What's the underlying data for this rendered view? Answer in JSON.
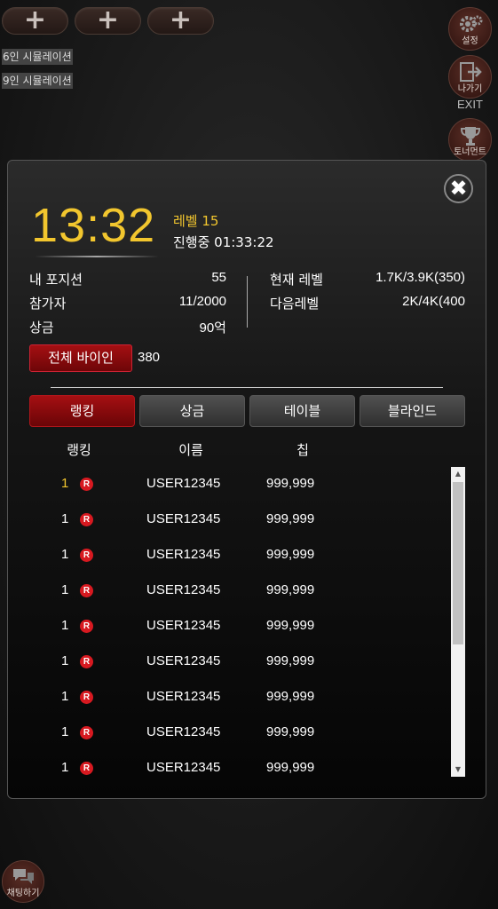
{
  "top_buttons": [
    "+",
    "+",
    "+"
  ],
  "sim_buttons": [
    "6인 시뮬레이션",
    "9인 시뮬레이션"
  ],
  "side": {
    "settings_label": "설정",
    "exit_label": "나가기",
    "exit_text": "EXIT",
    "tournament_label": "토너먼트"
  },
  "modal": {
    "close": "✖",
    "clock": "13:32",
    "level": "레벨 15",
    "progress": "진행중 01:33:22",
    "stats_left": [
      {
        "label": "내 포지션",
        "value": "55"
      },
      {
        "label": "참가자",
        "value": "11/2000"
      },
      {
        "label": "상금",
        "value": "90억"
      }
    ],
    "stats_right": [
      {
        "label": "현재 레벨",
        "value": "1.7K/3.9K(350)"
      },
      {
        "label": "다음레벨",
        "value": "2K/4K(400"
      }
    ],
    "buyin_label": "전체 바이인",
    "buyin_value": "380",
    "tabs": [
      "랭킹",
      "상금",
      "테이블",
      "블라인드"
    ],
    "active_tab": "랭킹",
    "columns": [
      "랭킹",
      "이름",
      "칩"
    ],
    "rows": [
      {
        "rank": "1",
        "badge": "R",
        "name": "USER12345",
        "chips": "999,999"
      },
      {
        "rank": "1",
        "badge": "R",
        "name": "USER12345",
        "chips": "999,999"
      },
      {
        "rank": "1",
        "badge": "R",
        "name": "USER12345",
        "chips": "999,999"
      },
      {
        "rank": "1",
        "badge": "R",
        "name": "USER12345",
        "chips": "999,999"
      },
      {
        "rank": "1",
        "badge": "R",
        "name": "USER12345",
        "chips": "999,999"
      },
      {
        "rank": "1",
        "badge": "R",
        "name": "USER12345",
        "chips": "999,999"
      },
      {
        "rank": "1",
        "badge": "R",
        "name": "USER12345",
        "chips": "999,999"
      },
      {
        "rank": "1",
        "badge": "R",
        "name": "USER12345",
        "chips": "999,999"
      },
      {
        "rank": "1",
        "badge": "R",
        "name": "USER12345",
        "chips": "999,999"
      }
    ],
    "first_rank_color": "#f2c62e"
  },
  "chat_label": "채팅하기",
  "colors": {
    "accent_gold": "#f2c62e",
    "accent_red": "#a50f12"
  }
}
